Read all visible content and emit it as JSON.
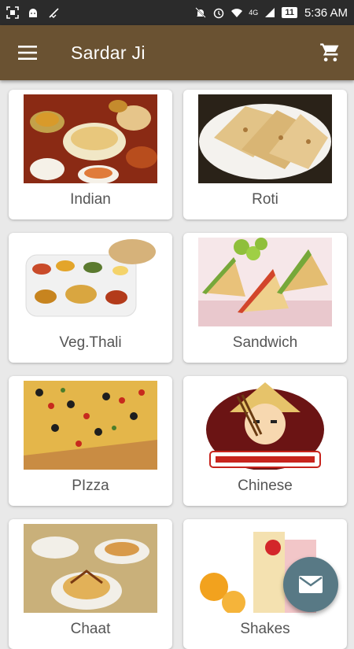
{
  "status_bar": {
    "network": "4G",
    "battery": "11",
    "time": "5:36 AM"
  },
  "app_bar": {
    "title": "Sardar Ji",
    "menu_icon": "hamburger-menu-icon",
    "cart_icon": "shopping-cart-icon"
  },
  "categories": [
    {
      "label": "Indian"
    },
    {
      "label": "Roti"
    },
    {
      "label": "Veg.Thali"
    },
    {
      "label": "Sandwich"
    },
    {
      "label": "PIzza"
    },
    {
      "label": "Chinese"
    },
    {
      "label": "Chaat"
    },
    {
      "label": "Shakes"
    }
  ],
  "fab": {
    "icon": "mail-icon"
  },
  "colors": {
    "app_bar": "#6a5232",
    "status_bar": "#2b2b2b",
    "background": "#e9e9e9",
    "fab": "#587985"
  }
}
